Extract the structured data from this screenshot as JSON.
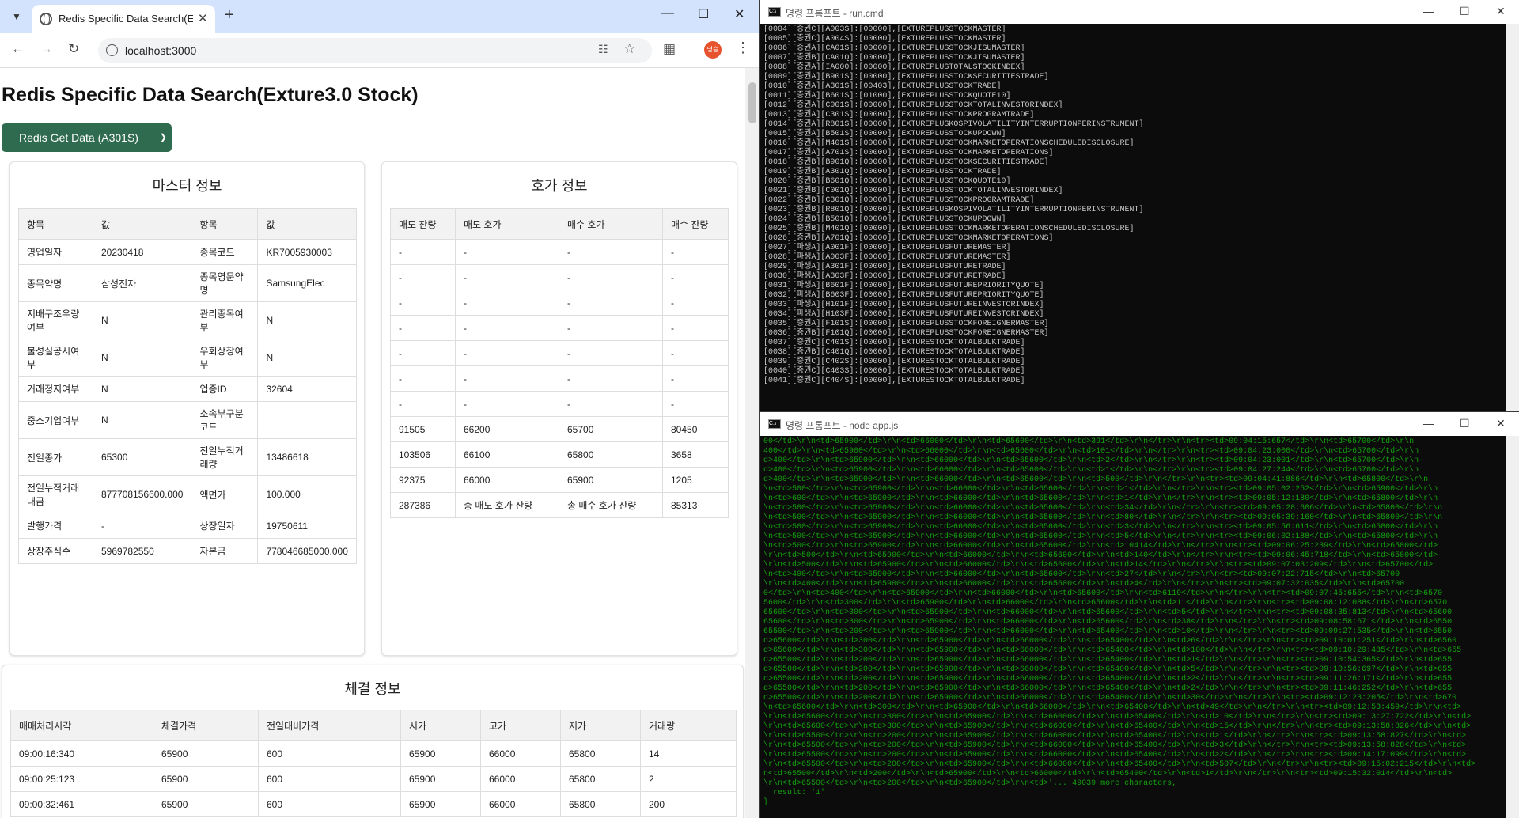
{
  "browser": {
    "tab_title": "Redis Specific Data Search(Exture3.0 Stock)",
    "url": "localhost:3000",
    "profile_label": "명승"
  },
  "page": {
    "title": "Redis Specific Data Search(Exture3.0 Stock)",
    "select_value": "Redis Get Data (A301S)",
    "master": {
      "heading": "마스터 정보",
      "headers": [
        "항목",
        "값",
        "항목",
        "값"
      ],
      "rows": [
        [
          "영업일자",
          "20230418",
          "종목코드",
          "KR7005930003"
        ],
        [
          "종목약명",
          "삼성전자",
          "종목영문약명",
          "SamsungElec"
        ],
        [
          "지배구조우량여부",
          "N",
          "관리종목여부",
          "N"
        ],
        [
          "불성실공시여부",
          "N",
          "우회상장여부",
          "N"
        ],
        [
          "거래정지여부",
          "N",
          "업종ID",
          "32604"
        ],
        [
          "중소기업여부",
          "N",
          "소속부구분코드",
          ""
        ],
        [
          "전일종가",
          "65300",
          "전일누적거래량",
          "13486618"
        ],
        [
          "전일누적거래대금",
          "877708156600.000",
          "액면가",
          "100.000"
        ],
        [
          "발행가격",
          "-",
          "상장일자",
          "19750611"
        ],
        [
          "상장주식수",
          "5969782550",
          "자본금",
          "778046685000.000"
        ]
      ]
    },
    "quote": {
      "heading": "호가 정보",
      "headers": [
        "매도 잔량",
        "매도 호가",
        "매수 호가",
        "매수 잔량"
      ],
      "rows": [
        [
          "-",
          "-",
          "-",
          "-"
        ],
        [
          "-",
          "-",
          "-",
          "-"
        ],
        [
          "-",
          "-",
          "-",
          "-"
        ],
        [
          "-",
          "-",
          "-",
          "-"
        ],
        [
          "-",
          "-",
          "-",
          "-"
        ],
        [
          "-",
          "-",
          "-",
          "-"
        ],
        [
          "-",
          "-",
          "-",
          "-"
        ],
        [
          "91505",
          "66200",
          "65700",
          "80450"
        ],
        [
          "103506",
          "66100",
          "65800",
          "3658"
        ],
        [
          "92375",
          "66000",
          "65900",
          "1205"
        ],
        [
          "287386",
          "총 매도 호가 잔량",
          "총 매수 호가 잔량",
          "85313"
        ]
      ]
    },
    "trade": {
      "heading": "체결 정보",
      "headers": [
        "매매처리시각",
        "체결가격",
        "전일대비가격",
        "시가",
        "고가",
        "저가",
        "거래량"
      ],
      "rows": [
        [
          "09:00:16:340",
          "65900",
          "600",
          "65900",
          "66000",
          "65800",
          "14"
        ],
        [
          "09:00:25:123",
          "65900",
          "600",
          "65900",
          "66000",
          "65800",
          "2"
        ],
        [
          "09:00:32:461",
          "65900",
          "600",
          "65900",
          "66000",
          "65800",
          "200"
        ]
      ]
    }
  },
  "console1": {
    "title": "명령 프롬프트 - run.cmd",
    "color": "#c8c8c8",
    "lines": [
      "[0004][증권C][A003S]:[00000],[EXTUREPLUSSTOCKMASTER]",
      "[0005][증권C][A004S]:[00000],[EXTUREPLUSSTOCKMASTER]",
      "[0006][증권A][CA01S]:[00000],[EXTUREPLUSSTOCKJISUMASTER]",
      "[0007][증권B][CA01Q]:[00000],[EXTUREPLUSSTOCKJISUMASTER]",
      "[0008][증권A][IA000]:[00000],[EXTUREPLUSTOTALSTOCKINDEX]",
      "[0009][증권A][B901S]:[00000],[EXTUREPLUSSTOCKSECURITIESTRADE]",
      "[0010][증권A][A301S]:[00403],[EXTUREPLUSSTOCKTRADE]",
      "[0011][증권A][B601S]:[01000],[EXTUREPLUSSTOCKQUOTE10]",
      "[0012][증권A][C001S]:[00000],[EXTUREPLUSSTOCKTOTALINVESTORINDEX]",
      "[0013][증권A][C301S]:[00000],[EXTUREPLUSSTOCKPROGRAMTRADE]",
      "[0014][증권A][R801S]:[00000],[EXTUREPLUSKOSPIVOLATILITYINTERRUPTIONPERINSTRUMENT]",
      "[0015][증권A][B501S]:[00000],[EXTUREPLUSSTOCKUPDOWN]",
      "[0016][증권A][M401S]:[00000],[EXTUREPLUSSTOCKMARKETOPERATIONSCHEDULEDISCLOSURE]",
      "[0017][증권A][A701S]:[00000],[EXTUREPLUSSTOCKMARKETOPERATIONS]",
      "[0018][증권B][B901Q]:[00000],[EXTUREPLUSSTOCKSECURITIESTRADE]",
      "[0019][증권B][A301Q]:[00000],[EXTUREPLUSSTOCKTRADE]",
      "[0020][증권B][B601Q]:[00000],[EXTUREPLUSSTOCKQUOTE10]",
      "[0021][증권B][C001Q]:[00000],[EXTUREPLUSSTOCKTOTALINVESTORINDEX]",
      "[0022][증권B][C301Q]:[00000],[EXTUREPLUSSTOCKPROGRAMTRADE]",
      "[0023][증권B][R801Q]:[00000],[EXTUREPLUSKOSPIVOLATILITYINTERRUPTIONPERINSTRUMENT]",
      "[0024][증권B][B501Q]:[00000],[EXTUREPLUSSTOCKUPDOWN]",
      "[0025][증권B][M401Q]:[00000],[EXTUREPLUSSTOCKMARKETOPERATIONSCHEDULEDISCLOSURE]",
      "[0026][증권B][A701Q]:[00000],[EXTUREPLUSSTOCKMARKETOPERATIONS]",
      "[0027][파생A][A001F]:[00000],[EXTUREPLUSFUTUREMASTER]",
      "[0028][파생A][A003F]:[00000],[EXTUREPLUSFUTUREMASTER]",
      "[0029][파생A][A301F]:[00000],[EXTUREPLUSFUTURETRADE]",
      "[0030][파생A][A303F]:[00000],[EXTUREPLUSFUTURETRADE]",
      "[0031][파생A][B601F]:[00000],[EXTUREPLUSFUTUREPRIORITYQUOTE]",
      "[0032][파생A][B603F]:[00000],[EXTUREPLUSFUTUREPRIORITYQUOTE]",
      "[0033][파생A][H101F]:[00000],[EXTUREPLUSFUTUREINVESTORINDEX]",
      "[0034][파생A][H103F]:[00000],[EXTUREPLUSFUTUREINVESTORINDEX]",
      "[0035][증권A][F101S]:[00000],[EXTUREPLUSSTOCKFOREIGNERMASTER]",
      "[0036][증권B][F101Q]:[00000],[EXTUREPLUSSTOCKFOREIGNERMASTER]",
      "[0037][증권C][C401S]:[00000],[EXTURESTOCKTOTALBULKTRADE]",
      "[0038][증권B][C401Q]:[00000],[EXTURESTOCKTOTALBULKTRADE]",
      "[0039][증권C][C402S]:[00000],[EXTURESTOCKTOTALBULKTRADE]",
      "[0040][증권C][C403S]:[00000],[EXTURESTOCKTOTALBULKTRADE]",
      "[0041][증권C][C404S]:[00000],[EXTURESTOCKTOTALBULKTRADE]"
    ]
  },
  "console2": {
    "title": "명령 프롬프트 - node  app.js",
    "color": "#13a10e",
    "lines": [
      "00</td>\\r\\n<td>65900</td>\\r\\n<td>66000</td>\\r\\n<td>65600</td>\\r\\n<td>391</td>\\r\\n</tr>\\r\\n<tr><td>09:04:15:657</td>\\r\\n<td>65700</td>\\r\\n",
      "400</td>\\r\\n<td>65900</td>\\r\\n<td>66000</td>\\r\\n<td>65600</td>\\r\\n<td>101</td>\\r\\n</tr>\\r\\n<tr><td>09:04:23:000</td>\\r\\n<td>65700</td>\\r\\n",
      "d>400</td>\\r\\n<td>65900</td>\\r\\n<td>66000</td>\\r\\n<td>65600</td>\\r\\n<td>2</td>\\r\\n</tr>\\r\\n<tr><td>09:04:23:001</td>\\r\\n<td>65700</td>\\r\\n",
      "d>400</td>\\r\\n<td>65900</td>\\r\\n<td>66000</td>\\r\\n<td>65600</td>\\r\\n<td>1</td>\\r\\n</tr>\\r\\n<tr><td>09:04:27:244</td>\\r\\n<td>65700</td>\\r\\n",
      "d>400</td>\\r\\n<td>65900</td>\\r\\n<td>66000</td>\\r\\n<td>65600</td>\\r\\n<td>500</td>\\r\\n</tr>\\r\\n<tr><td>09:04:41:886</td>\\r\\n<td>65800</td>\\r\\n",
      "\\n<td>500</td>\\r\\n<td>65900</td>\\r\\n<td>66000</td>\\r\\n<td>65600</td>\\r\\n<td>1</td>\\r\\n</tr>\\r\\n<tr><td>09:05:02:252</td>\\r\\n<td>65900</td>\\r\\n",
      "\\n<td>600</td>\\r\\n<td>65900</td>\\r\\n<td>66000</td>\\r\\n<td>65600</td>\\r\\n<td>1</td>\\r\\n</tr>\\r\\n<tr><td>09:05:12:180</td>\\r\\n<td>65800</td>\\r\\n",
      "\\n<td>500</td>\\r\\n<td>65900</td>\\r\\n<td>66000</td>\\r\\n<td>65600</td>\\r\\n<td>34</td>\\r\\n</tr>\\r\\n<tr><td>09:05:28:606</td>\\r\\n<td>65800</td>\\r\\n",
      "\\n<td>500</td>\\r\\n<td>65900</td>\\r\\n<td>66000</td>\\r\\n<td>65600</td>\\r\\n<td>80</td>\\r\\n</tr>\\r\\n<tr><td>09:05:39:160</td>\\r\\n<td>65800</td>\\r\\n",
      "\\n<td>500</td>\\r\\n<td>65900</td>\\r\\n<td>66000</td>\\r\\n<td>65600</td>\\r\\n<td>3</td>\\r\\n</tr>\\r\\n<tr><td>09:05:56:611</td>\\r\\n<td>65800</td>\\r\\n",
      "\\n<td>500</td>\\r\\n<td>65900</td>\\r\\n<td>66000</td>\\r\\n<td>65600</td>\\r\\n<td>5</td>\\r\\n</tr>\\r\\n<tr><td>09:06:02:188</td>\\r\\n<td>65800</td>\\r\\n",
      "\\n<td>500</td>\\r\\n<td>65900</td>\\r\\n<td>66000</td>\\r\\n<td>65600</td>\\r\\n<td>10414</td>\\r\\n</tr>\\r\\n<tr><td>09:06:25:239</td>\\r\\n<td>65800</td>",
      "\\r\\n<td>500</td>\\r\\n<td>65900</td>\\r\\n<td>66000</td>\\r\\n<td>65600</td>\\r\\n<td>140</td>\\r\\n</tr>\\r\\n<tr><td>09:06:45:718</td>\\r\\n<td>65800</td>",
      "\\r\\n<td>500</td>\\r\\n<td>65900</td>\\r\\n<td>66000</td>\\r\\n<td>65600</td>\\r\\n<td>14</td>\\r\\n</tr>\\r\\n<tr><td>09:07:03:209</td>\\r\\n<td>65700</td>",
      "\\n<td>400</td>\\r\\n<td>65900</td>\\r\\n<td>66000</td>\\r\\n<td>65600</td>\\r\\n<td>27</td>\\r\\n</tr>\\r\\n<tr><td>09:07:22:715</td>\\r\\n<td>65700",
      "\\r\\n<td>400</td>\\r\\n<td>65900</td>\\r\\n<td>66000</td>\\r\\n<td>65600</td>\\r\\n<td>4</td>\\r\\n</tr>\\r\\n<tr><td>09:07:32:035</td>\\r\\n<td>65700",
      "0</td>\\r\\n<td>400</td>\\r\\n<td>65900</td>\\r\\n<td>66000</td>\\r\\n<td>65600</td>\\r\\n<td>6119</td>\\r\\n</tr>\\r\\n<tr><td>09:07:45:655</td>\\r\\n<td>6570",
      "5600</td>\\r\\n<td>300</td>\\r\\n<td>65900</td>\\r\\n<td>66000</td>\\r\\n<td>65600</td>\\r\\n<td>11</td>\\r\\n</tr>\\r\\n<tr><td>09:08:12:088</td>\\r\\n<td>6570",
      "65600</td>\\r\\n<td>300</td>\\r\\n<td>65900</td>\\r\\n<td>66000</td>\\r\\n<td>65600</td>\\r\\n<td>5</td>\\r\\n</tr>\\r\\n<tr><td>09:08:35:813</td>\\r\\n<td>65600",
      "65600</td>\\r\\n<td>300</td>\\r\\n<td>65900</td>\\r\\n<td>66000</td>\\r\\n<td>65600</td>\\r\\n<td>38</td>\\r\\n</tr>\\r\\n<tr><td>09:08:58:671</td>\\r\\n<td>6550",
      "65500</td>\\r\\n<td>200</td>\\r\\n<td>65900</td>\\r\\n<td>66000</td>\\r\\n<td>65400</td>\\r\\n<td>10</td>\\r\\n</tr>\\r\\n<tr><td>09:09:27:535</td>\\r\\n<td>6550",
      "d>65600</td>\\r\\n<td>300</td>\\r\\n<td>65900</td>\\r\\n<td>66000</td>\\r\\n<td>65400</td>\\r\\n<td>6</td>\\r\\n</tr>\\r\\n<tr><td>09:10:01:251</td>\\r\\n<td>6560",
      "d>65600</td>\\r\\n<td>300</td>\\r\\n<td>65900</td>\\r\\n<td>66000</td>\\r\\n<td>65400</td>\\r\\n<td>100</td>\\r\\n</tr>\\r\\n<tr><td>09:10:29:485</td>\\r\\n<td>655",
      "d>65500</td>\\r\\n<td>200</td>\\r\\n<td>65900</td>\\r\\n<td>66000</td>\\r\\n<td>65400</td>\\r\\n<td>1</td>\\r\\n</tr>\\r\\n<tr><td>09:10:54:365</td>\\r\\n<td>655",
      "d>65500</td>\\r\\n<td>200</td>\\r\\n<td>65900</td>\\r\\n<td>66000</td>\\r\\n<td>65400</td>\\r\\n<td>5</td>\\r\\n</tr>\\r\\n<tr><td>09:10:56:697</td>\\r\\n<td>655",
      "d>65500</td>\\r\\n<td>200</td>\\r\\n<td>65900</td>\\r\\n<td>66000</td>\\r\\n<td>65400</td>\\r\\n<td>2</td>\\r\\n</tr>\\r\\n<tr><td>09:11:26:171</td>\\r\\n<td>655",
      "d>65500</td>\\r\\n<td>200</td>\\r\\n<td>65900</td>\\r\\n<td>66000</td>\\r\\n<td>65400</td>\\r\\n<td>2</td>\\r\\n</tr>\\r\\n<tr><td>09:11:46:252</td>\\r\\n<td>655",
      "d>65500</td>\\r\\n<td>200</td>\\r\\n<td>65900</td>\\r\\n<td>66000</td>\\r\\n<td>65400</td>\\r\\n<td>30</td>\\r\\n</tr>\\r\\n<tr><td>09:12:23:205</td>\\r\\n<td>670",
      "\\n<td>65600</td>\\r\\n<td>300</td>\\r\\n<td>65900</td>\\r\\n<td>66000</td>\\r\\n<td>65400</td>\\r\\n<td>49</td>\\r\\n</tr>\\r\\n<tr><td>09:12:53:459</td>\\r\\n<td>",
      "\\r\\n<td>65600</td>\\r\\n<td>300</td>\\r\\n<td>65900</td>\\r\\n<td>66000</td>\\r\\n<td>65400</td>\\r\\n<td>10</td>\\r\\n</tr>\\r\\n<tr><td>09:13:27:722</td>\\r\\n<td>",
      "\\r\\n<td>65600</td>\\r\\n<td>300</td>\\r\\n<td>65900</td>\\r\\n<td>66000</td>\\r\\n<td>65400</td>\\r\\n<td>15</td>\\r\\n</tr>\\r\\n<tr><td>09:13:58:826</td>\\r\\n<td>",
      "\\r\\n<td>65500</td>\\r\\n<td>200</td>\\r\\n<td>65900</td>\\r\\n<td>66000</td>\\r\\n<td>65400</td>\\r\\n<td>1</td>\\r\\n</tr>\\r\\n<tr><td>09:13:58:827</td>\\r\\n<td>",
      "\\r\\n<td>65500</td>\\r\\n<td>200</td>\\r\\n<td>65900</td>\\r\\n<td>66000</td>\\r\\n<td>65400</td>\\r\\n<td>3</td>\\r\\n</tr>\\r\\n<tr><td>09:13:58:828</td>\\r\\n<td>",
      "\\r\\n<td>65500</td>\\r\\n<td>200</td>\\r\\n<td>65900</td>\\r\\n<td>66000</td>\\r\\n<td>65400</td>\\r\\n<td>2</td>\\r\\n</tr>\\r\\n<tr><td>09:14:17:099</td>\\r\\n<td>",
      "\\r\\n<td>65500</td>\\r\\n<td>200</td>\\r\\n<td>65900</td>\\r\\n<td>66000</td>\\r\\n<td>65400</td>\\r\\n<td>507</td>\\r\\n</tr>\\r\\n<tr><td>09:15:02:215</td>\\r\\n<td>",
      "n<td>65500</td>\\r\\n<td>200</td>\\r\\n<td>65900</td>\\r\\n<td>66000</td>\\r\\n<td>65400</td>\\r\\n<td>1</td>\\r\\n</tr>\\r\\n<tr><td>09:15:32:014</td>\\r\\n<td>",
      "\\r\\n<td>65500</td>\\r\\n<td>200</td>\\r\\n<td>65900</td>\\r\\n<td>'... 49039 more characters,",
      "  result: '1'",
      "}"
    ]
  }
}
